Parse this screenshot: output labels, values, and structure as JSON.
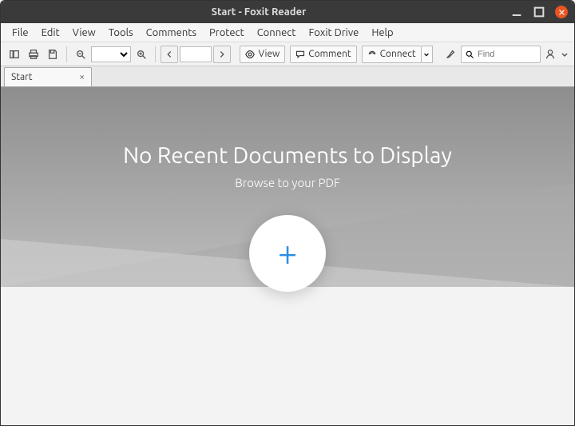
{
  "window": {
    "title": "Start - Foxit Reader"
  },
  "menu": {
    "items": [
      "File",
      "Edit",
      "View",
      "Tools",
      "Comments",
      "Protect",
      "Connect",
      "Foxit Drive",
      "Help"
    ]
  },
  "toolbar": {
    "view_label": "View",
    "comment_label": "Comment",
    "connect_label": "Connect",
    "find_placeholder": "Find"
  },
  "tabs": {
    "items": [
      {
        "label": "Start"
      }
    ]
  },
  "start_page": {
    "heading": "No Recent Documents to Display",
    "subheading": "Browse to your PDF"
  }
}
